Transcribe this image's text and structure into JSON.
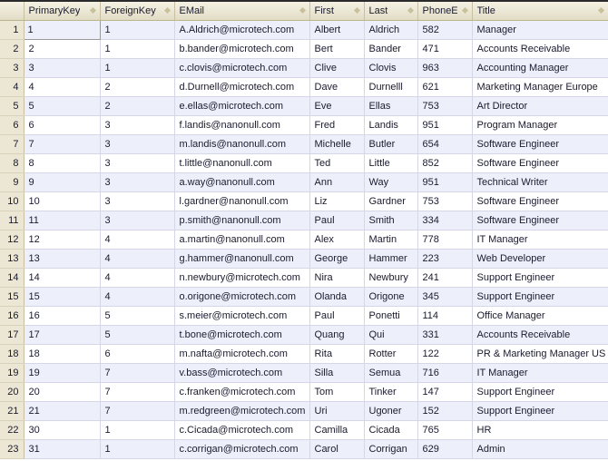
{
  "grid": {
    "row_number_header": "",
    "columns": [
      {
        "key": "primarykey",
        "label": "PrimaryKey",
        "filter_icon": "filter-dot-icon"
      },
      {
        "key": "foreignkey",
        "label": "ForeignKey",
        "filter_icon": "filter-dot-icon"
      },
      {
        "key": "email",
        "label": "EMail",
        "filter_icon": "filter-dot-icon"
      },
      {
        "key": "first",
        "label": "First",
        "filter_icon": "filter-dot-icon"
      },
      {
        "key": "last",
        "label": "Last",
        "filter_icon": "filter-dot-icon"
      },
      {
        "key": "phoneext",
        "label": "PhoneExt",
        "filter_icon": "filter-dot-icon"
      },
      {
        "key": "title",
        "label": "Title",
        "filter_icon": "filter-dot-icon"
      }
    ],
    "selected_cell": {
      "row": 1,
      "column": "primarykey"
    },
    "row_count": 23,
    "colors": {
      "header_background": "#ebe7d4",
      "header_border": "#c8c0a0",
      "row_odd_background": "#edf0fb",
      "row_even_background": "#ffffff",
      "rownum_background": "#ebe7d4",
      "grid_line": "#d5d7e6",
      "text": "#1a1a2e",
      "selection_border": "#9a9a9a",
      "top_rule": "#2b2b2b"
    },
    "rows": [
      {
        "n": "1",
        "primarykey": "1",
        "foreignkey": "1",
        "email": "A.Aldrich@microtech.com",
        "first": "Albert",
        "last": "Aldrich",
        "phoneext": "582",
        "title": "Manager"
      },
      {
        "n": "2",
        "primarykey": "2",
        "foreignkey": "1",
        "email": "b.bander@microtech.com",
        "first": "Bert",
        "last": "Bander",
        "phoneext": "471",
        "title": "Accounts Receivable"
      },
      {
        "n": "3",
        "primarykey": "3",
        "foreignkey": "1",
        "email": "c.clovis@microtech.com",
        "first": "Clive",
        "last": "Clovis",
        "phoneext": "963",
        "title": "Accounting Manager"
      },
      {
        "n": "4",
        "primarykey": "4",
        "foreignkey": "2",
        "email": "d.Durnell@microtech.com",
        "first": "Dave",
        "last": "Durnelll",
        "phoneext": "621",
        "title": "Marketing Manager Europe"
      },
      {
        "n": "5",
        "primarykey": "5",
        "foreignkey": "2",
        "email": "e.ellas@microtech.com",
        "first": "Eve",
        "last": "Ellas",
        "phoneext": "753",
        "title": "Art Director"
      },
      {
        "n": "6",
        "primarykey": "6",
        "foreignkey": "3",
        "email": "f.landis@nanonull.com",
        "first": "Fred",
        "last": "Landis",
        "phoneext": "951",
        "title": "Program Manager"
      },
      {
        "n": "7",
        "primarykey": "7",
        "foreignkey": "3",
        "email": "m.landis@nanonull.com",
        "first": "Michelle",
        "last": "Butler",
        "phoneext": "654",
        "title": "Software Engineer"
      },
      {
        "n": "8",
        "primarykey": "8",
        "foreignkey": "3",
        "email": "t.little@nanonull.com",
        "first": "Ted",
        "last": "Little",
        "phoneext": "852",
        "title": "Software Engineer"
      },
      {
        "n": "9",
        "primarykey": "9",
        "foreignkey": "3",
        "email": "a.way@nanonull.com",
        "first": "Ann",
        "last": "Way",
        "phoneext": "951",
        "title": "Technical Writer"
      },
      {
        "n": "10",
        "primarykey": "10",
        "foreignkey": "3",
        "email": "l.gardner@nanonull.com",
        "first": "Liz",
        "last": "Gardner",
        "phoneext": "753",
        "title": "Software Engineer"
      },
      {
        "n": "11",
        "primarykey": "11",
        "foreignkey": "3",
        "email": "p.smith@nanonull.com",
        "first": "Paul",
        "last": "Smith",
        "phoneext": "334",
        "title": "Software Engineer"
      },
      {
        "n": "12",
        "primarykey": "12",
        "foreignkey": "4",
        "email": "a.martin@nanonull.com",
        "first": "Alex",
        "last": "Martin",
        "phoneext": "778",
        "title": "IT Manager"
      },
      {
        "n": "13",
        "primarykey": "13",
        "foreignkey": "4",
        "email": "g.hammer@nanonull.com",
        "first": "George",
        "last": "Hammer",
        "phoneext": "223",
        "title": "Web Developer"
      },
      {
        "n": "14",
        "primarykey": "14",
        "foreignkey": "4",
        "email": "n.newbury@microtech.com",
        "first": "Nira",
        "last": "Newbury",
        "phoneext": "241",
        "title": "Support Engineer"
      },
      {
        "n": "15",
        "primarykey": "15",
        "foreignkey": "4",
        "email": "o.origone@microtech.com",
        "first": "Olanda",
        "last": "Origone",
        "phoneext": "345",
        "title": "Support Engineer"
      },
      {
        "n": "16",
        "primarykey": "16",
        "foreignkey": "5",
        "email": "s.meier@microtech.com",
        "first": "Paul",
        "last": "Ponetti",
        "phoneext": "114",
        "title": "Office Manager"
      },
      {
        "n": "17",
        "primarykey": "17",
        "foreignkey": "5",
        "email": "t.bone@microtech.com",
        "first": "Quang",
        "last": "Qui",
        "phoneext": "331",
        "title": "Accounts Receivable"
      },
      {
        "n": "18",
        "primarykey": "18",
        "foreignkey": "6",
        "email": "m.nafta@microtech.com",
        "first": "Rita",
        "last": "Rotter",
        "phoneext": "122",
        "title": "PR & Marketing Manager US"
      },
      {
        "n": "19",
        "primarykey": "19",
        "foreignkey": "7",
        "email": "v.bass@microtech.com",
        "first": "Silla",
        "last": "Semua",
        "phoneext": "716",
        "title": "IT Manager"
      },
      {
        "n": "20",
        "primarykey": "20",
        "foreignkey": "7",
        "email": "c.franken@microtech.com",
        "first": "Tom",
        "last": "Tinker",
        "phoneext": "147",
        "title": "Support Engineer"
      },
      {
        "n": "21",
        "primarykey": "21",
        "foreignkey": "7",
        "email": "m.redgreen@microtech.com",
        "first": "Uri",
        "last": "Ugoner",
        "phoneext": "152",
        "title": "Support Engineer"
      },
      {
        "n": "22",
        "primarykey": "30",
        "foreignkey": "1",
        "email": "c.Cicada@microtech.com",
        "first": "Camilla",
        "last": "Cicada",
        "phoneext": "765",
        "title": "HR"
      },
      {
        "n": "23",
        "primarykey": "31",
        "foreignkey": "1",
        "email": "c.corrigan@microtech.com",
        "first": "Carol",
        "last": "Corrigan",
        "phoneext": "629",
        "title": "Admin"
      }
    ]
  }
}
